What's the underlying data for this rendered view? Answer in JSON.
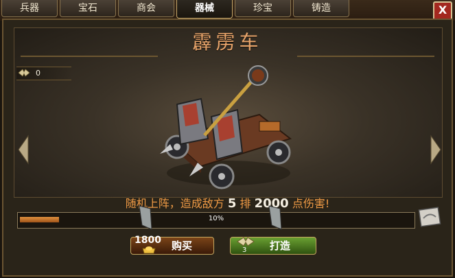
{
  "tabs": [
    {
      "label": "兵器"
    },
    {
      "label": "宝石"
    },
    {
      "label": "商会"
    },
    {
      "label": "器械",
      "active": true
    },
    {
      "label": "珍宝"
    },
    {
      "label": "铸造"
    }
  ],
  "close_label": "X",
  "title": "霹雳车",
  "resource": {
    "icon": "wing-coin-icon",
    "value": "0"
  },
  "description": {
    "prefix": "随机上阵，造成敌方",
    "rows": "5",
    "middle": "排",
    "damage": "2000",
    "suffix": "点伤害!"
  },
  "progress": {
    "percent_text": "10%",
    "fraction": 0.1
  },
  "buy": {
    "cost": "1800",
    "label": "购买",
    "icon": "gold-ingot-icon"
  },
  "forge": {
    "count": "3",
    "label": "打造",
    "icon": "wing-material-icon"
  },
  "colors": {
    "accent": "#ef9a45",
    "title": "#e8a46a",
    "progress": "#e0913e",
    "forge_green": "#5a8c2a"
  }
}
